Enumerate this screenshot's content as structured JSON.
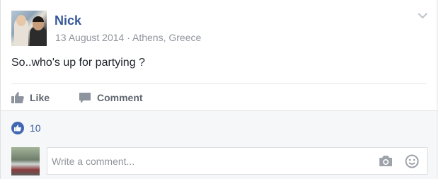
{
  "post": {
    "author": "Nick",
    "date": "13 August 2014",
    "separator": "·",
    "location": "Athens, Greece",
    "text": "So..who's up for partying ?"
  },
  "actions": {
    "like_label": "Like",
    "comment_label": "Comment"
  },
  "reactions": {
    "count": "10"
  },
  "comment_box": {
    "placeholder": "Write a comment..."
  },
  "colors": {
    "name_blue": "#365899",
    "meta_gray": "#90949c",
    "action_gray": "#606770",
    "reaction_blue": "#4267b2",
    "footer_bg": "#f6f7f9"
  },
  "icons": [
    "chevron-down-icon",
    "thumbs-up-icon",
    "comment-bubble-icon",
    "like-reaction-icon",
    "camera-icon",
    "emoji-icon"
  ]
}
